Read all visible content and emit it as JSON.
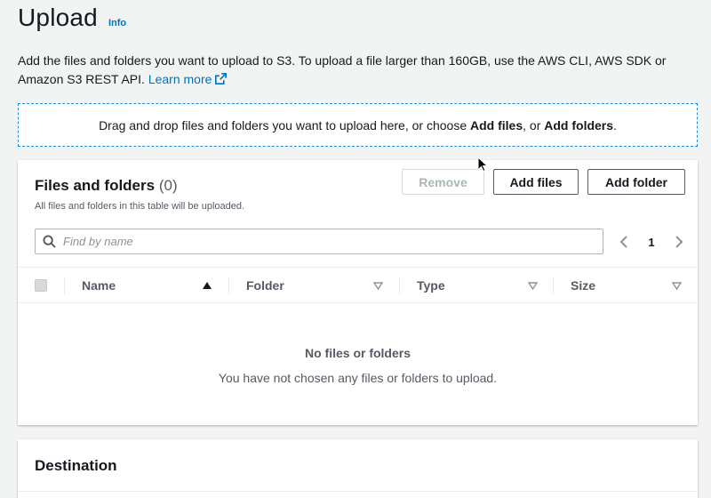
{
  "header": {
    "title": "Upload",
    "info_label": "Info"
  },
  "description": {
    "text": "Add the files and folders you want to upload to S3. To upload a file larger than 160GB, use the AWS CLI, AWS SDK or Amazon S3 REST API.",
    "learn_more": "Learn more"
  },
  "dropzone": {
    "prefix": "Drag and drop files and folders you want to upload here, or choose ",
    "add_files": "Add files",
    "middle": ", or ",
    "add_folders": "Add folders",
    "suffix": "."
  },
  "files_panel": {
    "title": "Files and folders",
    "count": "(0)",
    "subtitle": "All files and folders in this table will be uploaded.",
    "buttons": {
      "remove": "Remove",
      "add_files": "Add files",
      "add_folder": "Add folder"
    },
    "search": {
      "placeholder": "Find by name",
      "value": ""
    },
    "pagination": {
      "current_page": "1"
    },
    "columns": [
      "Name",
      "Folder",
      "Type",
      "Size"
    ],
    "empty_state": {
      "title": "No files or folders",
      "message": "You have not chosen any files or folders to upload."
    }
  },
  "destination": {
    "title": "Destination"
  },
  "colors": {
    "link": "#0073bb",
    "dropzone_border": "#1d8ad9",
    "background": "#f2f3f3",
    "panel": "#ffffff",
    "muted_text": "#545b64",
    "disabled_text": "#aab7b8"
  },
  "icons": {
    "external_link": "external-link-icon",
    "search": "search-icon",
    "prev_page": "chevron-left-icon",
    "next_page": "chevron-right-icon",
    "sort_asc": "sort-ascending-icon",
    "sort_none": "sort-caret-down-icon",
    "cursor": "mouse-pointer-icon"
  }
}
